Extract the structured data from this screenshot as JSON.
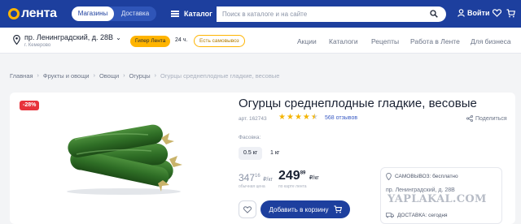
{
  "header": {
    "logo_text": "лента",
    "tabs": [
      "Магазины",
      "Доставка"
    ],
    "catalog_label": "Каталог",
    "search_placeholder": "Поиск в каталоге и на сайте",
    "login_label": "Войти"
  },
  "subheader": {
    "address": "пр. Ленинградский, д. 28В",
    "city": "г. Кемерово",
    "store_type": "Гипер Лента",
    "hours": "24 ч.",
    "pickup_badge": "Есть самовывоз",
    "nav": [
      "Акции",
      "Каталоги",
      "Рецепты",
      "Работа в Ленте",
      "Для бизнеса"
    ]
  },
  "breadcrumb": [
    "Главная",
    "Фрукты и овощи",
    "Овощи",
    "Огурцы",
    "Огурцы среднеплодные гладкие, весовые"
  ],
  "product": {
    "discount": "-28%",
    "title": "Огурцы среднеплодные гладкие, весовые",
    "article": "арт. 162743",
    "rating": 4.5,
    "reviews": "568 отзывов",
    "share": "Поделиться",
    "weight_label": "Фасовка:",
    "weights": [
      "0.5 кг",
      "1 кг"
    ],
    "old_price_main": "347",
    "old_price_cents": "16",
    "old_price_unit": "₽/кг",
    "new_price_main": "249",
    "new_price_cents": "89",
    "new_price_unit": "₽/кг",
    "old_note": "обычная цена",
    "new_note": "по карте лента",
    "add_to_cart": "Добавить в корзину"
  },
  "delivery": {
    "pickup": "САМОВЫВОЗ: бесплатно",
    "pickup_address": "пр. Ленинградский, д. 28В",
    "delivery": "ДОСТАВКА: сегодня"
  },
  "watermark": "YAPLAKAL.COM",
  "colors": {
    "brand_blue": "#1d3f9e",
    "accent_yellow": "#ffb400",
    "discount_red": "#e7323b",
    "star": "#f4b400"
  }
}
